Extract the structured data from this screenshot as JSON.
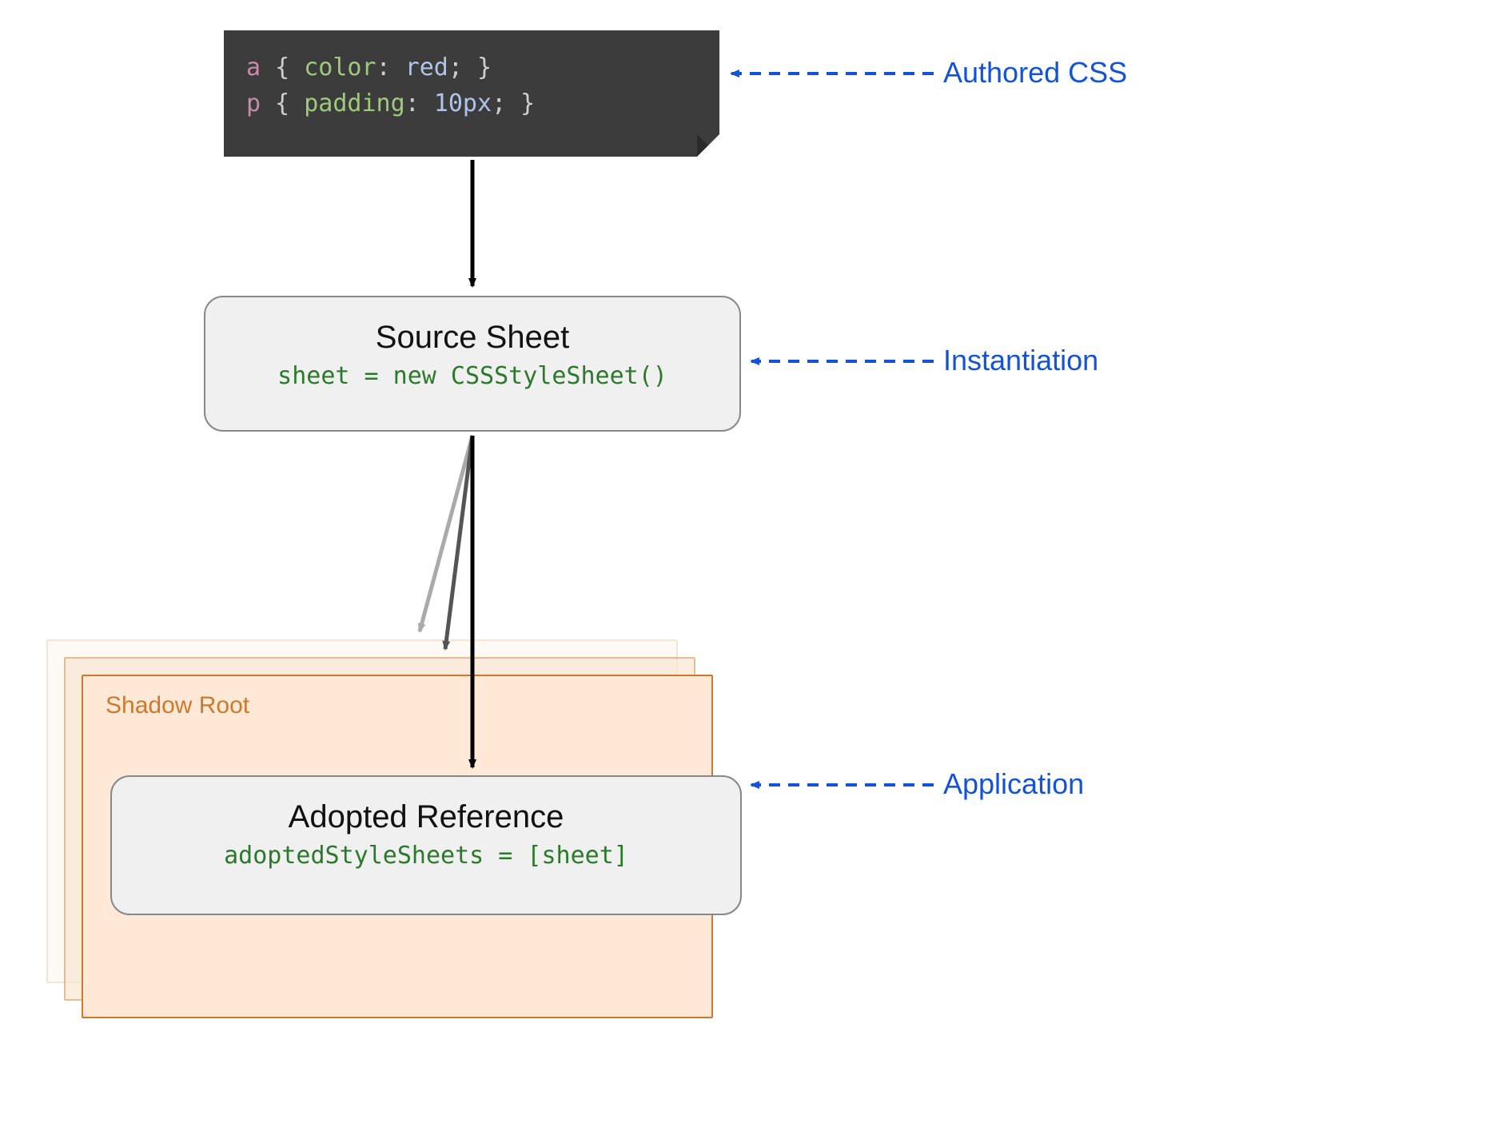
{
  "diagram": {
    "code": {
      "line1": {
        "selector": "a",
        "brace_open": " { ",
        "prop": "color",
        "colon": ": ",
        "value": "red",
        "close": "; }"
      },
      "line2": {
        "selector": "p",
        "brace_open": " { ",
        "prop": "padding",
        "colon": ": ",
        "value": "10px",
        "close": "; }"
      }
    },
    "source_sheet": {
      "title": "Source Sheet",
      "code": "sheet = new CSSStyleSheet()"
    },
    "shadow_root": {
      "label": "Shadow Root"
    },
    "adopted": {
      "title": "Adopted Reference",
      "code": "adoptedStyleSheets = [sheet]"
    },
    "annotations": {
      "authored": "Authored CSS",
      "instantiation": "Instantiation",
      "application": "Application"
    }
  }
}
